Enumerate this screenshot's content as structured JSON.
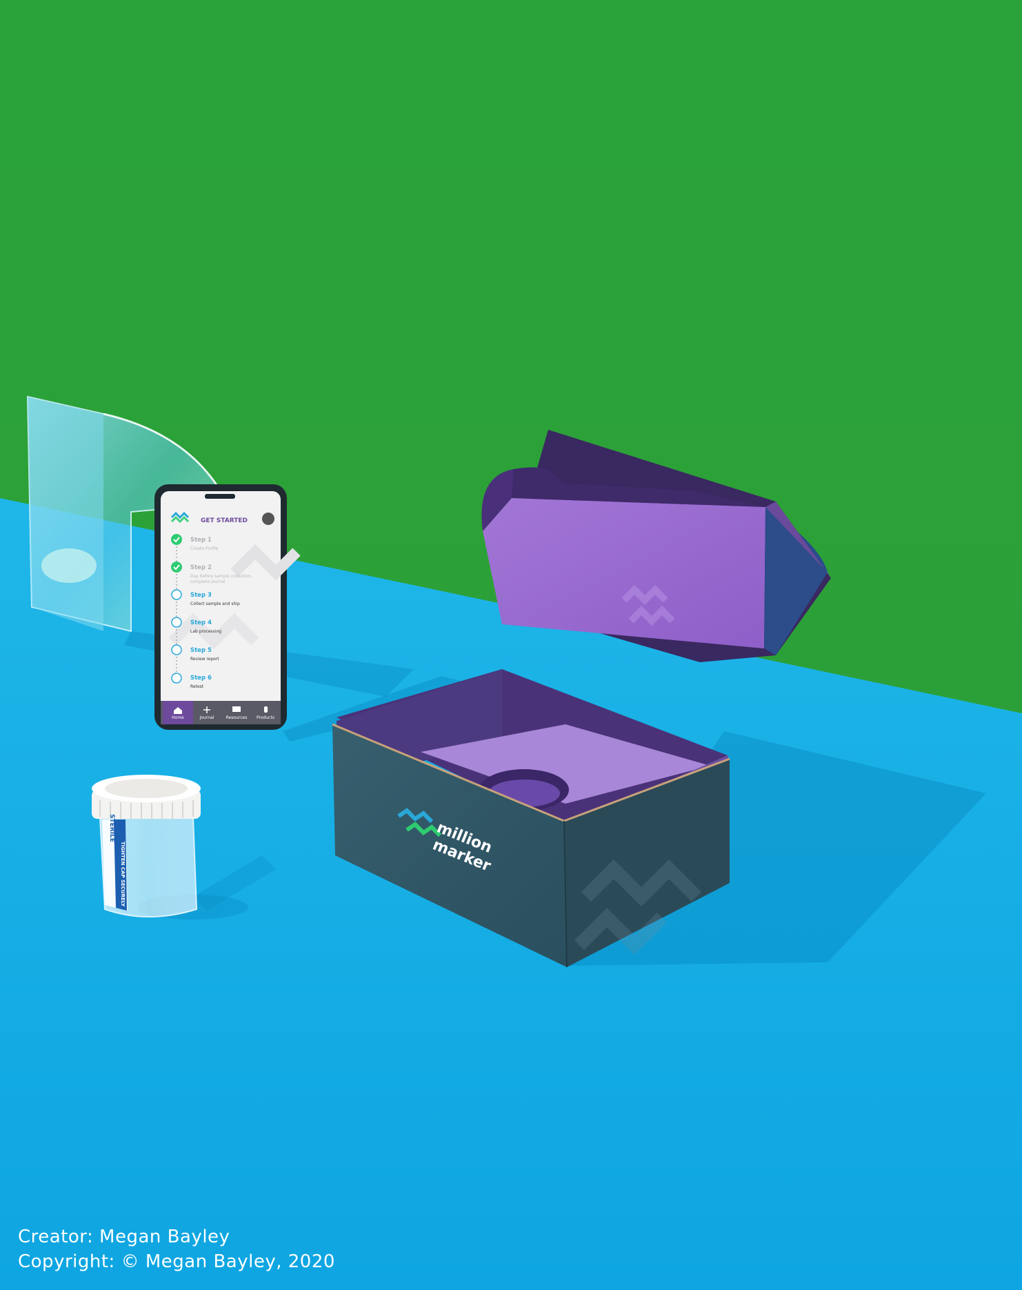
{
  "phone": {
    "header_title": "GET STARTED",
    "steps": [
      {
        "title": "Step 1",
        "desc1": "Create Profile",
        "desc2": "",
        "status": "done"
      },
      {
        "title": "Step 2",
        "desc1": "Day before sample collection,",
        "desc2": "complete journal",
        "status": "done"
      },
      {
        "title": "Step 3",
        "desc1": "Collect sample and ship",
        "desc2": "",
        "status": "todo"
      },
      {
        "title": "Step 4",
        "desc1": "Lab processing",
        "desc2": "",
        "status": "todo"
      },
      {
        "title": "Step 5",
        "desc1": "Review report",
        "desc2": "",
        "status": "todo"
      },
      {
        "title": "Step 6",
        "desc1": "Retest",
        "desc2": "",
        "status": "todo"
      }
    ],
    "nav": [
      {
        "label": "Home",
        "icon": "home-icon"
      },
      {
        "label": "Journal",
        "icon": "plus-icon"
      },
      {
        "label": "Resources",
        "icon": "book-icon"
      },
      {
        "label": "Products",
        "icon": "bottle-icon"
      }
    ]
  },
  "box": {
    "brand_line1": "million",
    "brand_line2": "marker"
  },
  "jar": {
    "label_text": "STERILE",
    "side_text": "TIGHTEN CAP SECURELY"
  },
  "credits": {
    "creator": "Creator: Megan Bayley",
    "copyright": "Copyright: © Megan Bayley, 2020"
  },
  "colors": {
    "wall": "#2ea53a",
    "floor": "#19aee4",
    "box_outer": "#2f5a6a",
    "box_inner": "#9a6ad0",
    "accent_purple": "#5a3a8c",
    "step_done": "#2ecc71",
    "step_todo": "#29a8d8"
  }
}
